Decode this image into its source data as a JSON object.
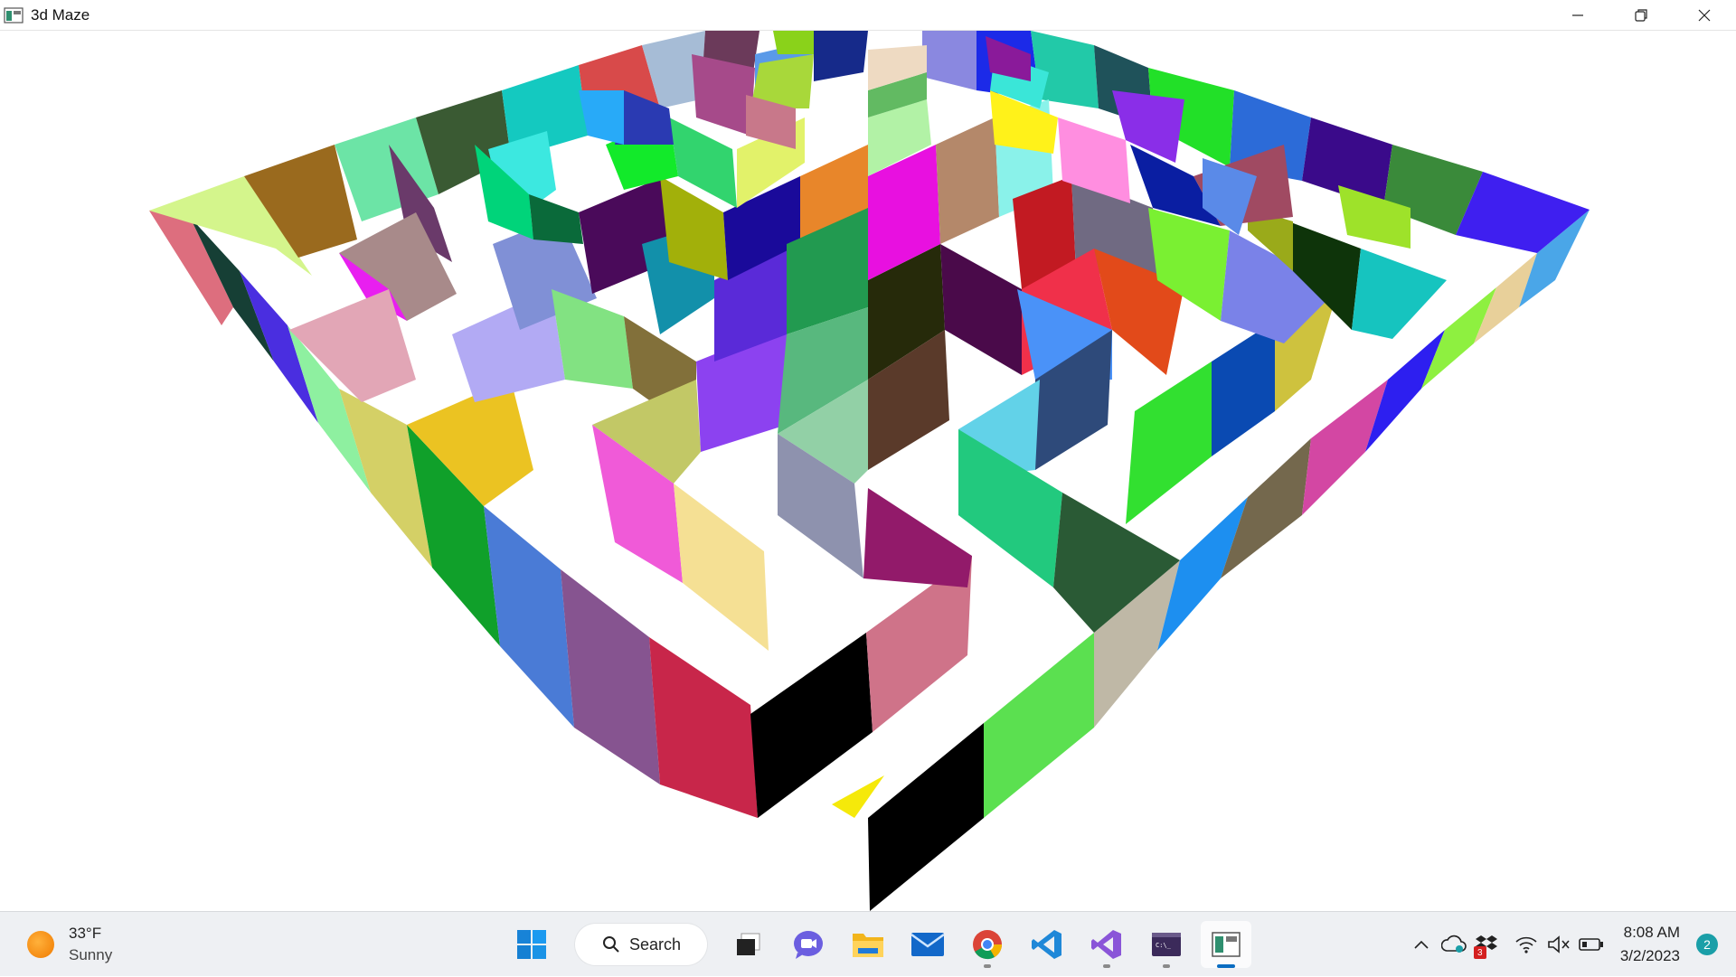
{
  "window": {
    "title": "3d Maze",
    "controls": [
      "minimize-icon",
      "restore-icon",
      "close-icon"
    ]
  },
  "scene": {
    "description_icon": "3d-maze-scene",
    "player_marker_color": "#f5e90a"
  },
  "taskbar": {
    "weather": {
      "temperature": "33°F",
      "condition": "Sunny",
      "icon": "sun-icon"
    },
    "search_label": "Search",
    "apps": [
      {
        "name": "start-icon"
      },
      {
        "name": "task-view-icon"
      },
      {
        "name": "chat-icon"
      },
      {
        "name": "file-explorer-icon"
      },
      {
        "name": "mail-icon"
      },
      {
        "name": "chrome-icon"
      },
      {
        "name": "vscode-icon"
      },
      {
        "name": "visual-studio-icon"
      },
      {
        "name": "terminal-icon"
      },
      {
        "name": "maze-app-icon"
      }
    ],
    "tray": {
      "time": "8:08 AM",
      "date": "3/2/2023",
      "notification_count": "2",
      "dropbox_badge": "3"
    }
  }
}
